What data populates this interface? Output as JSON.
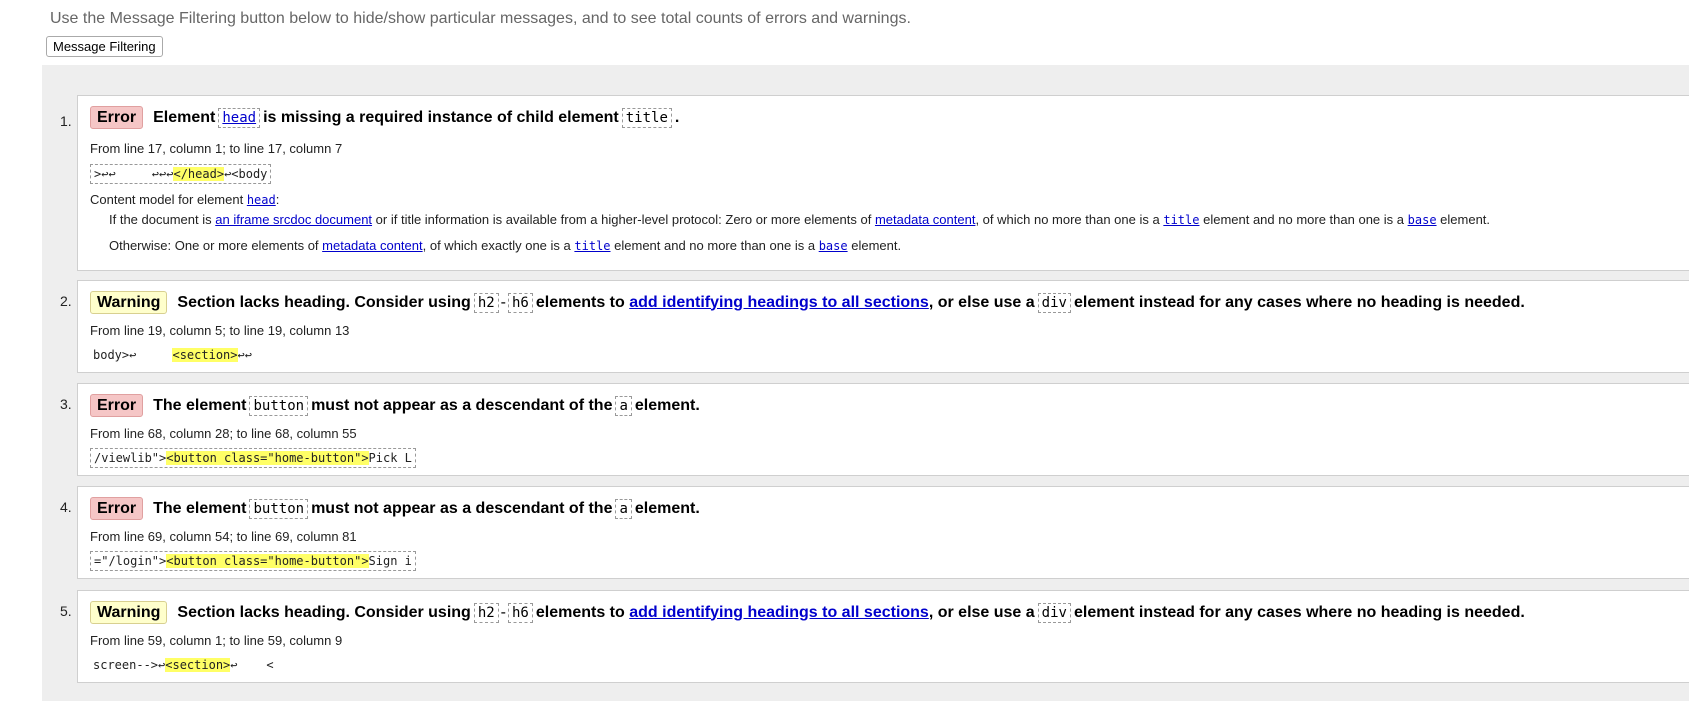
{
  "intro": "Use the Message Filtering button below to hide/show particular messages, and to see total counts of errors and warnings.",
  "filter_button": "Message Filtering",
  "messages": [
    {
      "num": "1.",
      "type": "Error",
      "text1": "Element",
      "code1": "head",
      "text2": "is missing a required instance of child element",
      "code2": "title",
      "text3": ".",
      "location": "From line 17, column 1; to line 17, column 7",
      "extract_pre": ">↩↩     ↩↩↩",
      "extract_hl": "</head>",
      "extract_post": "↩<body",
      "cm_label": "Content model for element",
      "cm_code": "head",
      "cm_colon": ":",
      "cm1_a": "If the document is",
      "cm1_link1": "an iframe srcdoc document",
      "cm1_b": "or if title information is available from a higher-level protocol: Zero or more elements of",
      "cm1_link2": "metadata content",
      "cm1_c": ", of which no more than one is a",
      "cm1_code1": "title",
      "cm1_d": "element and no more than one is a",
      "cm1_code2": "base",
      "cm1_e": "element.",
      "cm2_a": "Otherwise: One or more elements of",
      "cm2_link": "metadata content",
      "cm2_b": ", of which exactly one is a",
      "cm2_code1": "title",
      "cm2_c": "element and no more than one is a",
      "cm2_code2": "base",
      "cm2_d": "element."
    },
    {
      "num": "2.",
      "type": "Warning",
      "text1": "Section lacks heading. Consider using",
      "code1": "h2",
      "sep": "-",
      "code2": "h6",
      "text2": "elements to",
      "link": "add identifying headings to all sections",
      "text3": ", or else use a",
      "code3": "div",
      "text4": "element instead for any cases where no heading is needed.",
      "location": "From line 19, column 5; to line 19, column 13",
      "extract_pre": "body>↩     ",
      "extract_hl": "<section>",
      "extract_post": "↩↩"
    },
    {
      "num": "3.",
      "type": "Error",
      "text1": "The element",
      "code1": "button",
      "text2": "must not appear as a descendant of the",
      "code2": "a",
      "text3": "element.",
      "location": "From line 68, column 28; to line 68, column 55",
      "extract_pre": "/viewlib\">",
      "extract_hl": "<button class=\"home-button\">",
      "extract_post": "Pick L"
    },
    {
      "num": "4.",
      "type": "Error",
      "text1": "The element",
      "code1": "button",
      "text2": "must not appear as a descendant of the",
      "code2": "a",
      "text3": "element.",
      "location": "From line 69, column 54; to line 69, column 81",
      "extract_pre": "=\"/login\">",
      "extract_hl": "<button class=\"home-button\">",
      "extract_post": "Sign i"
    },
    {
      "num": "5.",
      "type": "Warning",
      "text1": "Section lacks heading. Consider using",
      "code1": "h2",
      "sep": "-",
      "code2": "h6",
      "text2": "elements to",
      "link": "add identifying headings to all sections",
      "text3": ", or else use a",
      "code3": "div",
      "text4": "element instead for any cases where no heading is needed.",
      "location": "From line 59, column 1; to line 59, column 9",
      "extract_pre": "screen-->↩",
      "extract_hl": "<section>",
      "extract_post": "↩    <"
    }
  ]
}
